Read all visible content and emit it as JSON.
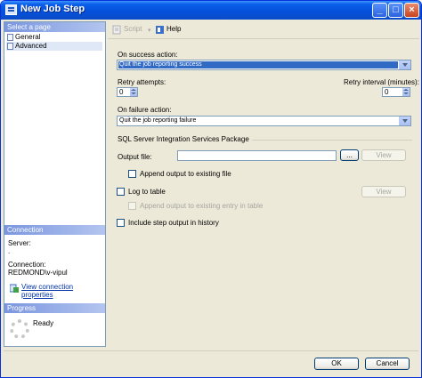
{
  "window": {
    "title": "New Job Step"
  },
  "left": {
    "select_page_header": "Select a page",
    "pages": [
      {
        "label": "General",
        "selected": false
      },
      {
        "label": "Advanced",
        "selected": true
      }
    ],
    "connection_header": "Connection",
    "server_label": "Server:",
    "server_value": ".",
    "connection_label": "Connection:",
    "connection_value": "REDMOND\\v-vipul",
    "view_connection_link": "View connection properties",
    "progress_header": "Progress",
    "progress_status": "Ready"
  },
  "toolbar": {
    "script_label": "Script",
    "help_label": "Help"
  },
  "form": {
    "on_success_label": "On success action:",
    "on_success_value": "Quit the job reporting success",
    "retry_attempts_label": "Retry attempts:",
    "retry_attempts_value": "0",
    "retry_interval_label": "Retry interval (minutes):",
    "retry_interval_value": "0",
    "on_failure_label": "On failure action:",
    "on_failure_value": "Quit the job reporting failure",
    "ssis_group_label": "SQL Server Integration Services Package",
    "output_file_label": "Output file:",
    "output_file_value": "",
    "browse_label": "...",
    "view_label": "View",
    "append_output_label": "Append output to existing file",
    "log_to_table_label": "Log to table",
    "view_table_label": "View",
    "append_entry_label": "Append output to existing entry in table",
    "include_history_label": "Include step output in history"
  },
  "footer": {
    "ok_label": "OK",
    "cancel_label": "Cancel"
  }
}
